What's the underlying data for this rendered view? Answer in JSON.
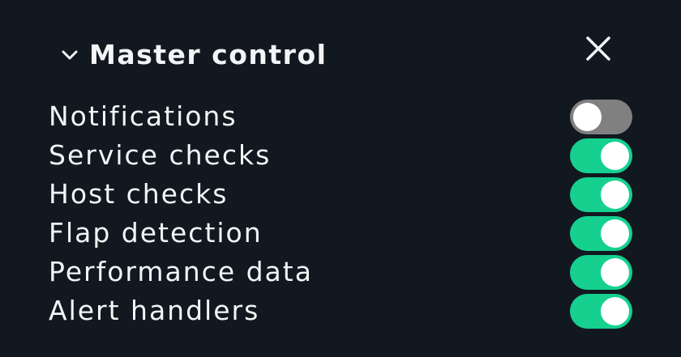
{
  "panel": {
    "title": "Master control",
    "expanded": true,
    "icons": {
      "collapse": "chevron-down-icon",
      "close": "close-icon"
    }
  },
  "colors": {
    "background": "#121820",
    "text": "#f2f4f6",
    "toggle_on": "#15d08f",
    "toggle_off": "#808080",
    "knob": "#ffffff"
  },
  "controls": [
    {
      "label": "Notifications",
      "enabled": false
    },
    {
      "label": "Service checks",
      "enabled": true
    },
    {
      "label": "Host checks",
      "enabled": true
    },
    {
      "label": "Flap detection",
      "enabled": true
    },
    {
      "label": "Performance data",
      "enabled": true
    },
    {
      "label": "Alert handlers",
      "enabled": true
    }
  ]
}
